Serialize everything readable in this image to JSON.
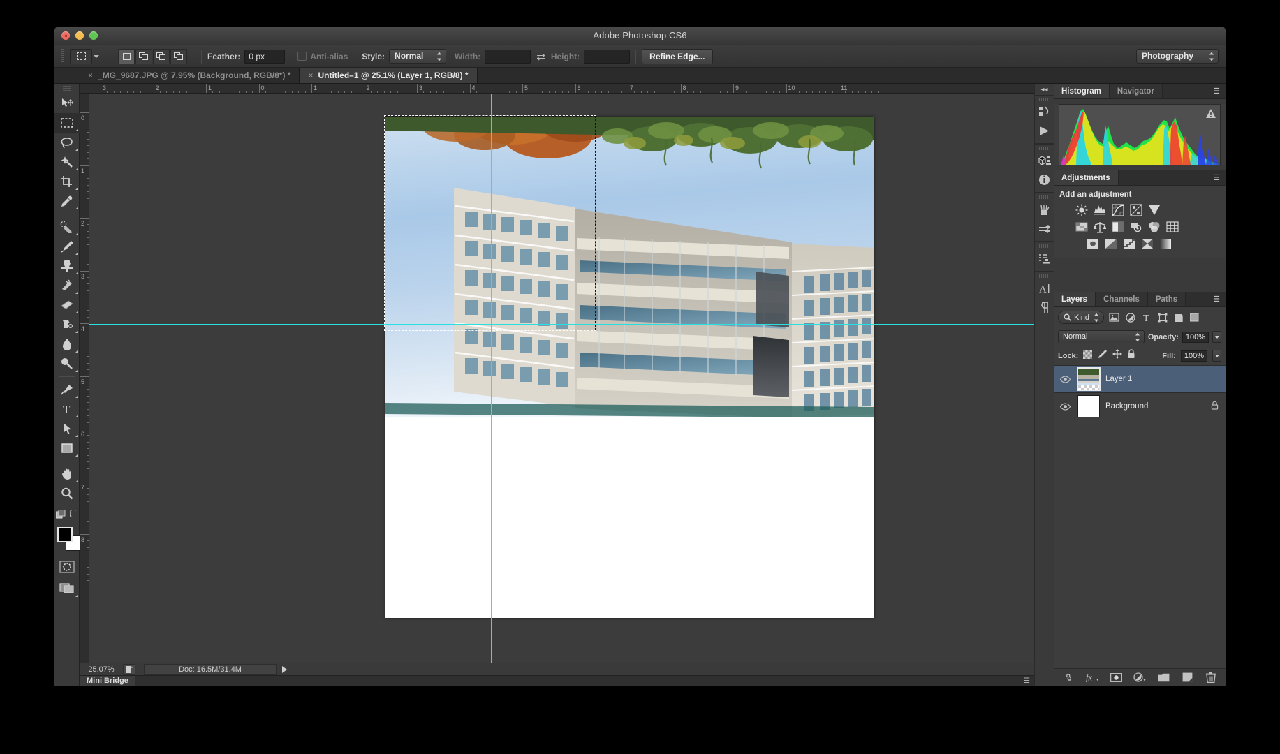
{
  "window": {
    "title": "Adobe Photoshop CS6",
    "traffic": {
      "close": "close-button",
      "minimize": "minimize-button",
      "maximize": "maximize-button"
    }
  },
  "options_bar": {
    "tool_preset_icon": "rectangular-marquee-icon",
    "selection_modes": [
      "new-selection",
      "add-to-selection",
      "subtract-from-selection",
      "intersect-selection"
    ],
    "feather_label": "Feather:",
    "feather_value": "0 px",
    "antialias_label": "Anti-alias",
    "antialias_checked": false,
    "style_label": "Style:",
    "style_value": "Normal",
    "width_label": "Width:",
    "width_value": "",
    "swap_icon": "swap-dimensions-icon",
    "height_label": "Height:",
    "height_value": "",
    "refine_edge_label": "Refine Edge...",
    "workspace_value": "Photography"
  },
  "tabs": [
    {
      "close": "×",
      "label": "_MG_9687.JPG @ 7.95% (Background, RGB/8*) *",
      "active": false
    },
    {
      "close": "×",
      "label": "Untitled–1 @ 25.1% (Layer 1, RGB/8) *",
      "active": true
    }
  ],
  "toolbar": {
    "tools": [
      {
        "name": "move-tool",
        "active": false,
        "has_flyout": false
      },
      {
        "name": "rectangular-marquee-tool",
        "active": true,
        "has_flyout": true
      },
      {
        "name": "lasso-tool",
        "active": false,
        "has_flyout": true
      },
      {
        "name": "quick-selection-tool",
        "active": false,
        "has_flyout": true
      },
      {
        "name": "crop-tool",
        "active": false,
        "has_flyout": true
      },
      {
        "name": "eyedropper-tool",
        "active": false,
        "has_flyout": true
      },
      {
        "name": "spot-healing-brush-tool",
        "active": false,
        "has_flyout": true
      },
      {
        "name": "brush-tool",
        "active": false,
        "has_flyout": true
      },
      {
        "name": "clone-stamp-tool",
        "active": false,
        "has_flyout": true
      },
      {
        "name": "history-brush-tool",
        "active": false,
        "has_flyout": true
      },
      {
        "name": "eraser-tool",
        "active": false,
        "has_flyout": true
      },
      {
        "name": "gradient-tool",
        "active": false,
        "has_flyout": true
      },
      {
        "name": "blur-tool",
        "active": false,
        "has_flyout": true
      },
      {
        "name": "dodge-tool",
        "active": false,
        "has_flyout": true
      },
      {
        "name": "pen-tool",
        "active": false,
        "has_flyout": true
      },
      {
        "name": "type-tool",
        "active": false,
        "has_flyout": true
      },
      {
        "name": "path-selection-tool",
        "active": false,
        "has_flyout": true
      },
      {
        "name": "rectangle-shape-tool",
        "active": false,
        "has_flyout": true
      },
      {
        "name": "hand-tool",
        "active": false,
        "has_flyout": true
      },
      {
        "name": "zoom-tool",
        "active": false,
        "has_flyout": false
      }
    ],
    "default_colors_icon": "default-colors-icon",
    "swap_colors_icon": "swap-colors-icon",
    "foreground_color": "#000000",
    "background_color": "#ffffff",
    "quick_mask_icon": "quick-mask-icon",
    "screen_mode_icon": "screen-mode-icon"
  },
  "rulers": {
    "horizontal_labels": [
      "3",
      "2",
      "1",
      "0",
      "1",
      "2",
      "3",
      "4",
      "5",
      "6",
      "7",
      "8",
      "9",
      "10",
      "11"
    ],
    "vertical_labels": [
      "0",
      "1",
      "2",
      "3",
      "4",
      "5",
      "6",
      "7",
      "8"
    ],
    "unit": "inches"
  },
  "status": {
    "zoom": "25.07%",
    "thumbnail_icon": "doc-proxy-icon",
    "doc_info": "Doc: 16.5M/31.4M",
    "expand_icon": "status-expand-arrow",
    "mini_bridge_label": "Mini Bridge",
    "panel_menu_icon": "panel-menu-icon"
  },
  "dock_strip": {
    "collapse_icon": "collapse-panels-icon",
    "groups": [
      [
        "history-icon",
        "actions-play-icon"
      ],
      [
        "3d-icon",
        "info-icon"
      ],
      [
        "brush-preset-icon",
        "brush-settings-icon"
      ],
      [
        "clone-source-icon"
      ],
      [
        "character-icon",
        "paragraph-icon"
      ]
    ]
  },
  "panels": {
    "histogram": {
      "tabs": [
        {
          "label": "Histogram",
          "active": true
        },
        {
          "label": "Navigator",
          "active": false
        }
      ],
      "menu_icon": "panel-menu-icon",
      "warning_icon": "cached-data-warning-icon"
    },
    "adjustments": {
      "tabs": [
        {
          "label": "Adjustments",
          "active": true
        }
      ],
      "menu_icon": "panel-menu-icon",
      "heading": "Add an adjustment",
      "rows": [
        [
          "brightness-contrast-icon",
          "levels-icon",
          "curves-icon",
          "exposure-icon",
          "vibrance-icon"
        ],
        [
          "color-balance-icon",
          "black-and-white-icon",
          "photo-filter-icon",
          "channel-mixer-icon",
          "color-lookup-icon",
          "posterize-icon"
        ],
        [
          "invert-icon",
          "threshold-icon",
          "selective-color-icon",
          "gradient-map-icon",
          "hue-saturation-icon"
        ]
      ]
    },
    "layers": {
      "tabs": [
        {
          "label": "Layers",
          "active": true
        },
        {
          "label": "Channels",
          "active": false
        },
        {
          "label": "Paths",
          "active": false
        }
      ],
      "menu_icon": "panel-menu-icon",
      "filter_kind_label": "Kind",
      "filter_search_icon": "search-icon",
      "filter_icons": [
        "pixel-layer-filter-icon",
        "adjustment-layer-filter-icon",
        "type-layer-filter-icon",
        "shape-layer-filter-icon",
        "smart-object-filter-icon"
      ],
      "filter_toggle_icon": "filter-toggle-icon",
      "blend_mode": "Normal",
      "opacity_label": "Opacity:",
      "opacity_value": "100%",
      "lock_label": "Lock:",
      "lock_icons": [
        "lock-transparent-pixels-icon",
        "lock-image-pixels-icon",
        "lock-position-icon",
        "lock-all-icon"
      ],
      "fill_label": "Fill:",
      "fill_value": "100%",
      "rows": [
        {
          "visible": true,
          "name": "Layer 1",
          "selected": true,
          "locked": false,
          "thumb": "photo-transparent-thumb"
        },
        {
          "visible": true,
          "name": "Background",
          "selected": false,
          "locked": true,
          "thumb": "white-thumb"
        }
      ],
      "footer_icons": [
        "link-layers-icon",
        "layer-style-fx-icon",
        "layer-mask-icon",
        "new-adjustment-layer-icon",
        "new-group-icon",
        "new-layer-icon",
        "delete-layer-icon"
      ]
    }
  },
  "canvas": {
    "selection_marquee": "marching-ants-selection",
    "guide_color": "#29e0e0",
    "horizontal_guide": true,
    "vertical_guide": true,
    "layer_content": "upside-down-building-photograph"
  }
}
